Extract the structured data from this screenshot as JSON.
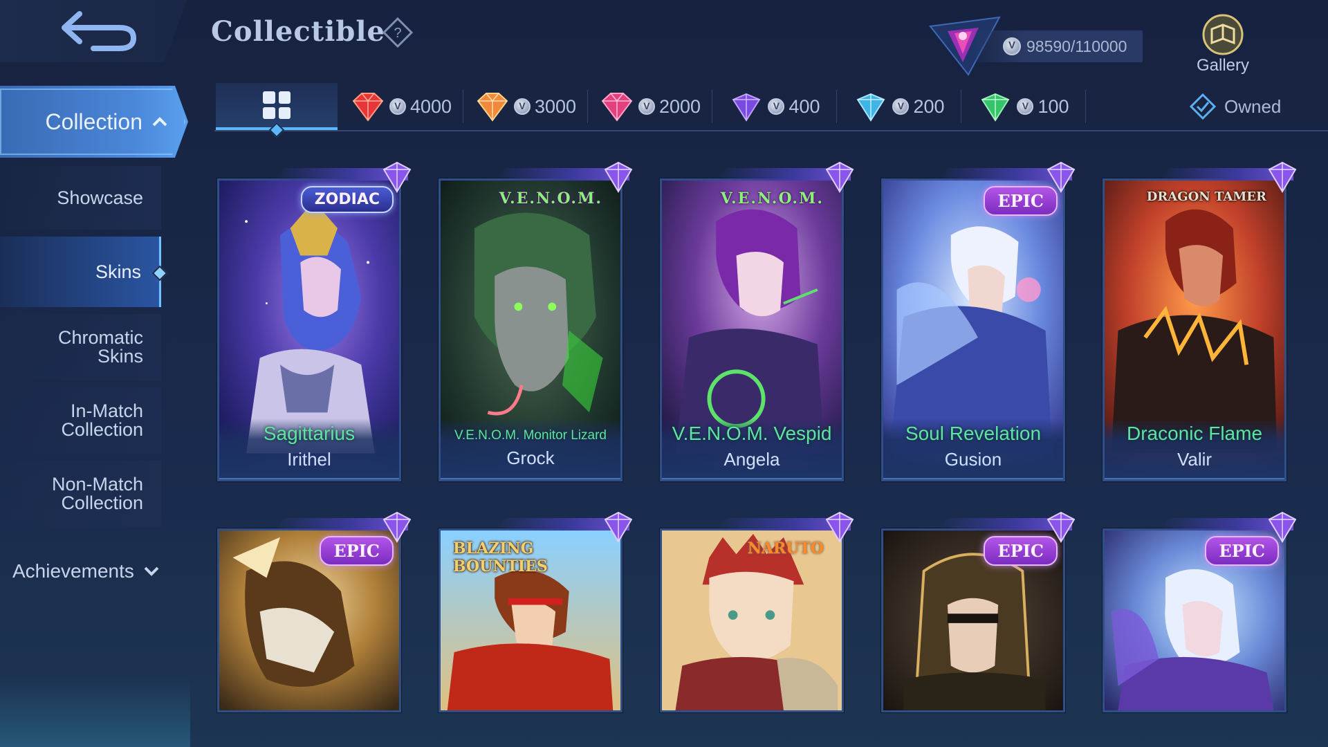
{
  "header": {
    "title": "Collectible",
    "points": "98590/110000",
    "gallery_label": "Gallery"
  },
  "tabs": {
    "all_icon": "grid-icon",
    "tiers": [
      {
        "cost": "4000",
        "gem_color": "#e8353a"
      },
      {
        "cost": "3000",
        "gem_color": "#f08a3a"
      },
      {
        "cost": "2000",
        "gem_color": "#e5407e"
      },
      {
        "cost": "400",
        "gem_color": "#7a4be0"
      },
      {
        "cost": "200",
        "gem_color": "#3fb4e6"
      },
      {
        "cost": "100",
        "gem_color": "#35c46a"
      }
    ],
    "owned_label": "Owned"
  },
  "sidebar": {
    "collection_label": "Collection",
    "items": [
      {
        "label": "Showcase"
      },
      {
        "label": "Skins"
      },
      {
        "line1": "Chromatic",
        "line2": "Skins"
      },
      {
        "line1": "In-Match",
        "line2": "Collection"
      },
      {
        "line1": "Non-Match",
        "line2": "Collection"
      }
    ],
    "achievements_label": "Achievements"
  },
  "cards": [
    {
      "series": "ZODIAC",
      "skin": "Sagittarius",
      "hero": "Irithel"
    },
    {
      "series": "V.E.N.O.M.",
      "skin": "V.E.N.O.M. Monitor Lizard",
      "hero": "Grock"
    },
    {
      "series": "V.E.N.O.M.",
      "skin": "V.E.N.O.M. Vespid",
      "hero": "Angela"
    },
    {
      "series": "EPIC",
      "skin": "Soul Revelation",
      "hero": "Gusion"
    },
    {
      "series": "DRAGON TAMER",
      "skin": "Draconic Flame",
      "hero": "Valir"
    },
    {
      "series": "EPIC"
    },
    {
      "series": "BLAZING BOUNTIES"
    },
    {
      "series": "NARUTO"
    },
    {
      "series": "EPIC"
    },
    {
      "series": "EPIC"
    }
  ],
  "accent_colors": {
    "active_tab": "#5bb8ff",
    "skin_name": "#5fe3a4",
    "epic_badge": "#9b3fd6"
  }
}
